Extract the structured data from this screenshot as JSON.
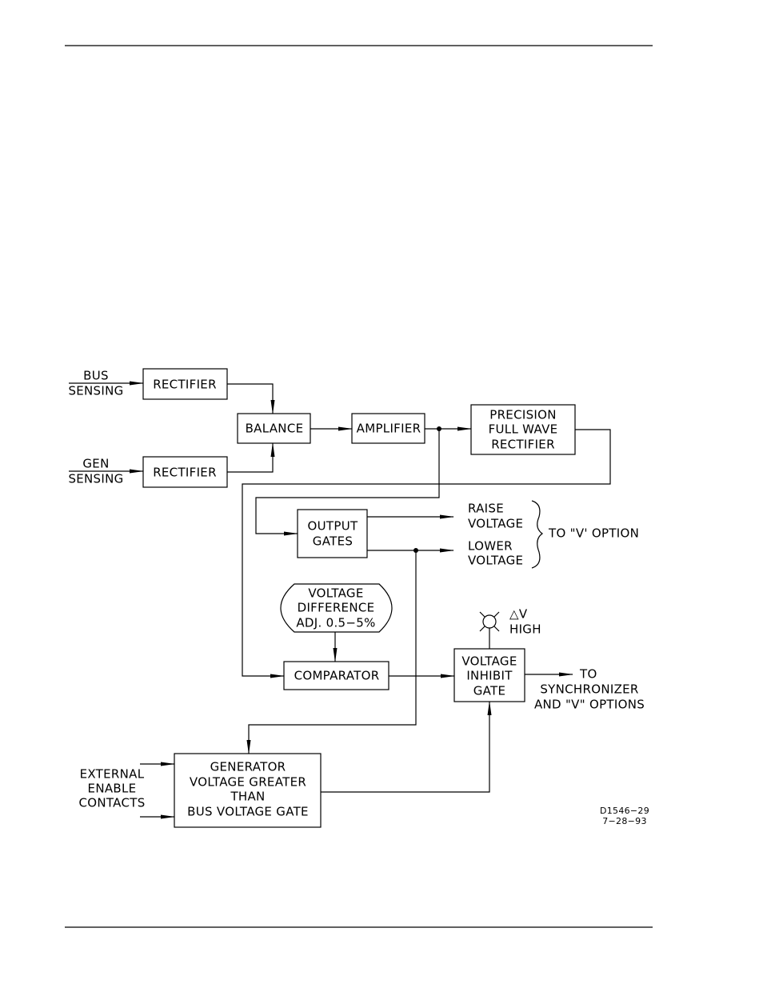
{
  "inputs": {
    "bus": [
      "BUS",
      "SENSING"
    ],
    "gen": [
      "GEN",
      "SENSING"
    ],
    "external": [
      "EXTERNAL",
      "ENABLE",
      "CONTACTS"
    ]
  },
  "blocks": {
    "rectifier_bus": [
      "RECTIFIER"
    ],
    "rectifier_gen": [
      "RECTIFIER"
    ],
    "balance": [
      "BALANCE"
    ],
    "amplifier": [
      "AMPLIFIER"
    ],
    "precision": [
      "PRECISION",
      "FULL WAVE",
      "RECTIFIER"
    ],
    "output_gates": [
      "OUTPUT",
      "GATES"
    ],
    "voltage_difference": [
      "VOLTAGE",
      "DIFFERENCE",
      "ADJ. 0.5−5%"
    ],
    "comparator": [
      "COMPARATOR"
    ],
    "inhibit": [
      "VOLTAGE",
      "INHIBIT",
      "GATE"
    ],
    "generator_gate": [
      "GENERATOR",
      "VOLTAGE GREATER",
      "THAN",
      "BUS VOLTAGE GATE"
    ]
  },
  "outputs": {
    "raise": [
      "RAISE",
      "VOLTAGE"
    ],
    "lower": [
      "LOWER",
      "VOLTAGE"
    ],
    "v_option": "TO \"V' OPTION",
    "lamp": [
      "△V",
      "HIGH"
    ],
    "sync": [
      "TO",
      "SYNCHRONIZER",
      "AND \"V\" OPTIONS"
    ]
  },
  "drawing_id": [
    "D1546−29",
    "7−28−93"
  ]
}
